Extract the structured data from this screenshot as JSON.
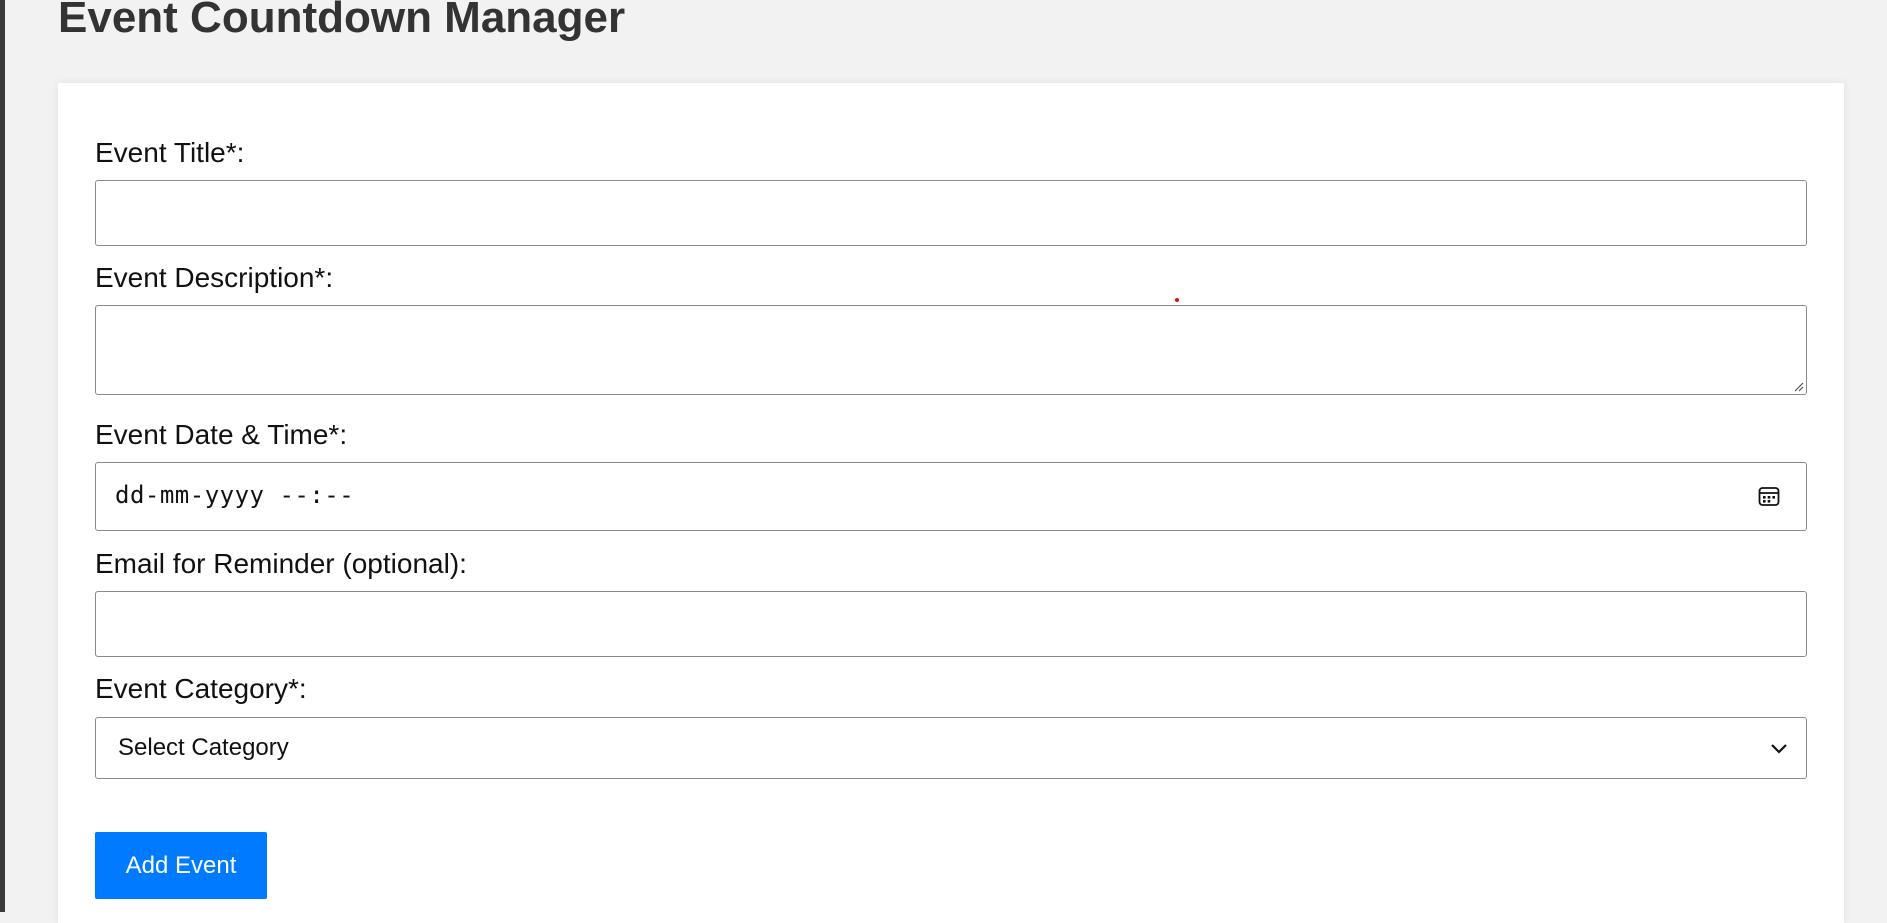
{
  "header": {
    "title": "Event Countdown Manager"
  },
  "form": {
    "title": {
      "label": "Event Title*:",
      "value": ""
    },
    "description": {
      "label": "Event Description*:",
      "value": ""
    },
    "datetime": {
      "label": "Event Date & Time*:",
      "placeholder": "dd-mm-yyyy --:--",
      "icon": "calendar-icon"
    },
    "email": {
      "label": "Email for Reminder (optional):",
      "value": ""
    },
    "category": {
      "label": "Event Category*:",
      "selected": "Select Category",
      "icon": "chevron-down-icon"
    },
    "submit_label": "Add Event"
  },
  "colors": {
    "accent": "#007bff",
    "page_background": "#f2f2f2",
    "card_background": "#ffffff",
    "title_text": "#333333"
  }
}
